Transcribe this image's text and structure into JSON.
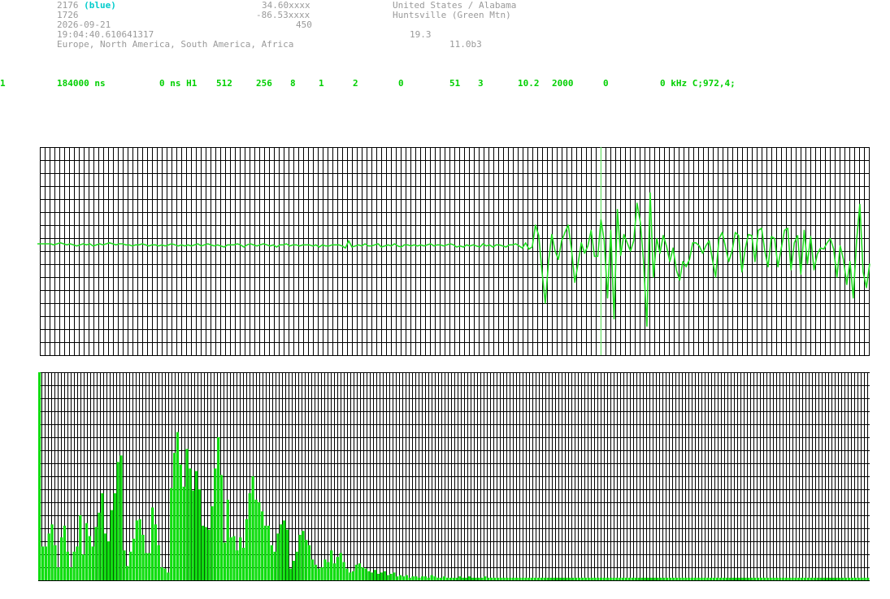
{
  "header": {
    "station_id": "2176",
    "station_color_label": "(blue)",
    "station_sub_id": "1726",
    "date": "2026-09-21",
    "time": "19:04:40.610641317",
    "regions": "Europe, North America, South America, Africa",
    "latitude": "34.60xxxx",
    "longitude": "-86.53xxxx",
    "altitude": "450",
    "country_state": "United States / Alabama",
    "location": "Huntsville (Green Mtn)",
    "value_a": "19.3",
    "version": "11.0b3"
  },
  "params": [
    "1",
    "184000 ns",
    "0 ns H1",
    "512",
    "256",
    "8",
    "1",
    "2",
    "0",
    "51",
    "3",
    "10.2",
    "2000",
    "0",
    "0 kHz C;972,4;"
  ],
  "colors": {
    "waveform": "#22dd22",
    "bars": "#11dd11",
    "grid": "#000000",
    "trigger": "#66dd66",
    "blue_label": "#00cccc",
    "header_text": "#9a9a9a"
  },
  "chart_data": [
    {
      "type": "line",
      "title": "",
      "xlabel": "",
      "ylabel": "",
      "grid": true,
      "samples": 256,
      "ylim": [
        -1,
        1
      ],
      "trigger_index": 172,
      "values": [
        0.07,
        0.07,
        0.07,
        0.07,
        0.07,
        0.06,
        0.07,
        0.08,
        0.07,
        0.06,
        0.07,
        0.06,
        0.05,
        0.06,
        0.07,
        0.06,
        0.07,
        0.05,
        0.06,
        0.07,
        0.06,
        0.07,
        0.08,
        0.07,
        0.06,
        0.07,
        0.07,
        0.06,
        0.06,
        0.05,
        0.06,
        0.06,
        0.07,
        0.06,
        0.05,
        0.06,
        0.06,
        0.05,
        0.06,
        0.05,
        0.06,
        0.07,
        0.06,
        0.05,
        0.06,
        0.05,
        0.06,
        0.05,
        0.06,
        0.07,
        0.05,
        0.06,
        0.07,
        0.06,
        0.05,
        0.06,
        0.05,
        0.04,
        0.06,
        0.06,
        0.06,
        0.07,
        0.06,
        0.04,
        0.06,
        0.07,
        0.06,
        0.05,
        0.06,
        0.07,
        0.06,
        0.05,
        0.06,
        0.04,
        0.06,
        0.06,
        0.07,
        0.05,
        0.06,
        0.06,
        0.05,
        0.06,
        0.06,
        0.06,
        0.05,
        0.06,
        0.04,
        0.06,
        0.05,
        0.05,
        0.06,
        0.06,
        0.06,
        0.05,
        0.03,
        0.1,
        0.04,
        0.05,
        0.06,
        0.05,
        0.07,
        0.05,
        0.05,
        0.06,
        0.07,
        0.04,
        0.05,
        0.06,
        0.05,
        0.07,
        0.05,
        0.04,
        0.06,
        0.06,
        0.05,
        0.06,
        0.05,
        0.06,
        0.05,
        0.06,
        0.07,
        0.05,
        0.06,
        0.06,
        0.05,
        0.06,
        0.07,
        0.06,
        0.04,
        0.05,
        0.04,
        0.06,
        0.05,
        0.06,
        0.05,
        0.04,
        0.07,
        0.05,
        0.06,
        0.04,
        0.06,
        0.06,
        0.05,
        0.04,
        0.06,
        0.06,
        0.07,
        0.05,
        0.03,
        0.08,
        0.02,
        0.04,
        0.25,
        0.15,
        -0.2,
        -0.5,
        -0.1,
        0.16,
        0.0,
        -0.08,
        0.1,
        0.18,
        0.25,
        0.02,
        -0.3,
        -0.12,
        0.08,
        -0.02,
        0.05,
        0.2,
        -0.05,
        -0.05,
        0.3,
        0.1,
        -0.45,
        0.2,
        -0.65,
        0.4,
        -0.04,
        0.16,
        0.08,
        0.0,
        0.1,
        0.46,
        0.28,
        -0.1,
        -0.72,
        0.56,
        -0.25,
        0.12,
        -0.02,
        0.15,
        0.05,
        -0.1,
        0.03,
        -0.18,
        -0.28,
        -0.1,
        -0.15,
        -0.08,
        0.08,
        0.08,
        0.05,
        -0.02,
        0.05,
        0.1,
        -0.08,
        -0.25,
        0.12,
        0.18,
        0.04,
        -0.1,
        0.0,
        0.18,
        0.15,
        -0.2,
        0.02,
        0.16,
        0.15,
        -0.1,
        0.2,
        0.22,
        0.0,
        -0.15,
        0.14,
        0.12,
        -0.15,
        0.02,
        0.2,
        0.22,
        -0.18,
        0.08,
        0.15,
        -0.22,
        0.2,
        -0.12,
        0.14,
        -0.18,
        -0.03,
        0.03,
        0.02,
        0.08,
        0.12,
        0.02,
        -0.25,
        0.05,
        -0.08,
        -0.32,
        -0.1,
        -0.45,
        0.1,
        0.45,
        -0.2,
        -0.35,
        -0.12
      ]
    },
    {
      "type": "bar",
      "title": "",
      "xlabel": "",
      "ylabel": "",
      "grid": true,
      "ylim": [
        0,
        16
      ],
      "values": [
        16,
        2.6,
        2.6,
        3.6,
        4.3,
        2.7,
        1.0,
        3.3,
        4.2,
        2.2,
        1.0,
        2.2,
        2.6,
        5.0,
        2.0,
        4.4,
        3.4,
        2.6,
        4.1,
        5.2,
        6.7,
        3.6,
        3.0,
        5.4,
        6.7,
        9.1,
        9.6,
        2.3,
        1.1,
        2.2,
        3.2,
        4.6,
        4.7,
        3.5,
        2.1,
        2.1,
        5.6,
        4.3,
        2.7,
        1.0,
        0.9,
        0.6,
        7.1,
        9.8,
        11.4,
        8.9,
        7.2,
        10.1,
        8.6,
        6.9,
        8.4,
        7.0,
        4.2,
        4.1,
        3.9,
        5.7,
        8.6,
        11.0,
        8.1,
        2.9,
        6.2,
        3.3,
        3.4,
        2.3,
        3.3,
        2.5,
        4.7,
        6.7,
        8.0,
        6.2,
        6.0,
        5.3,
        4.2,
        4.2,
        2.7,
        2.2,
        3.6,
        4.3,
        4.6,
        3.9,
        0.9,
        1.5,
        2.2,
        3.5,
        3.8,
        3.1,
        2.7,
        1.6,
        1.2,
        0.9,
        1.0,
        1.6,
        1.4,
        2.3,
        1.3,
        1.8,
        2.1,
        1.4,
        0.9,
        0.6,
        0.7,
        1.2,
        1.3,
        1.0,
        0.9,
        0.7,
        0.6,
        0.8,
        0.5,
        0.6,
        0.7,
        0.4,
        0.5,
        0.6,
        0.3,
        0.4,
        0.3,
        0.4,
        0.2,
        0.3,
        0.3,
        0.2,
        0.3,
        0.3,
        0.2,
        0.4,
        0.3,
        0.2,
        0.2,
        0.3,
        0.2,
        0.2,
        0.2,
        0.2,
        0.3,
        0.2,
        0.2,
        0.3,
        0.2,
        0.2,
        0.2,
        0.2,
        0.3,
        0.2,
        0.2,
        0.2,
        0.2,
        0.2,
        0.2,
        0.2,
        0.2,
        0.2,
        0.2,
        0.2,
        0.2,
        0.2,
        0.2,
        0.2,
        0.2,
        0.2,
        0.2,
        0.2,
        0.2,
        0.2,
        0.2,
        0.2,
        0.2,
        0.2,
        0.2,
        0.2,
        0.2,
        0.2,
        0.2,
        0.2,
        0.2,
        0.2,
        0.2,
        0.2,
        0.2,
        0.2,
        0.2,
        0.2,
        0.2,
        0.2,
        0.2,
        0.2,
        0.2,
        0.2,
        0.2,
        0.2,
        0.2,
        0.2,
        0.2,
        0.2,
        0.2,
        0.2,
        0.2,
        0.2,
        0.2,
        0.2,
        0.2,
        0.2,
        0.2,
        0.2,
        0.2,
        0.2,
        0.2,
        0.2,
        0.2,
        0.2,
        0.2,
        0.2,
        0.2,
        0.2,
        0.2,
        0.2,
        0.2,
        0.2,
        0.2,
        0.2,
        0.2,
        0.2,
        0.2,
        0.2,
        0.2,
        0.2,
        0.2,
        0.2,
        0.2,
        0.2,
        0.2,
        0.2,
        0.2,
        0.2,
        0.2,
        0.2,
        0.2,
        0.2,
        0.2,
        0.2,
        0.2,
        0.2,
        0.2,
        0.2,
        0.2,
        0.2,
        0.2,
        0.2,
        0.2,
        0.2,
        0.2,
        0.2,
        0.2,
        0.2,
        0.2,
        0.2,
        0.2,
        0.2,
        0.2,
        0.2,
        0.2,
        0.2,
        0.2,
        0.2,
        0.2
      ]
    }
  ]
}
